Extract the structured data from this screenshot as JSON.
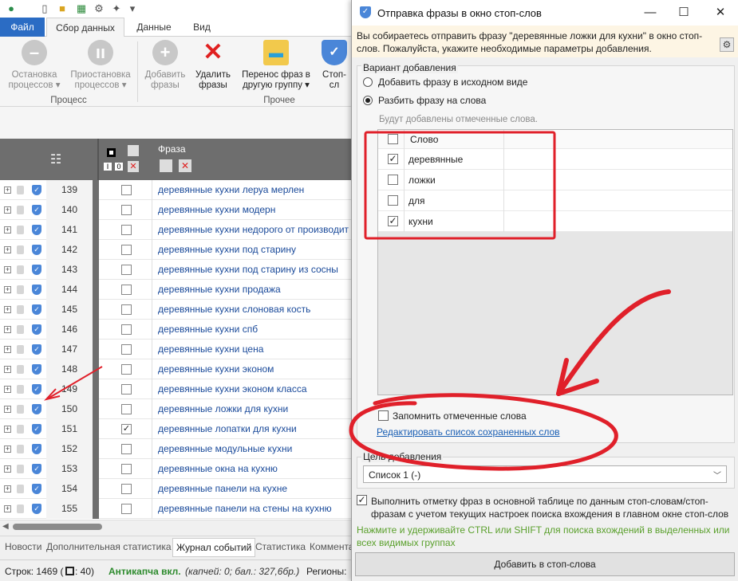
{
  "app": {
    "ribbon_tabs": [
      "Файл",
      "Сбор данных",
      "Данные",
      "Вид"
    ],
    "ribbon_buttons": [
      {
        "line1": "Остановка",
        "line2": "процессов ▾"
      },
      {
        "line1": "Приостановка",
        "line2": "процессов ▾"
      },
      {
        "line1": "Добавить",
        "line2": "фразы"
      },
      {
        "line1": "Удалить",
        "line2": "фразы"
      },
      {
        "line1": "Перенос фраз в",
        "line2": "другую группу ▾"
      },
      {
        "line1": "Стоп-сл",
        "line2": ""
      }
    ],
    "ribbon_groups": [
      "Процесс",
      "Прочее"
    ],
    "grid_header": {
      "phrase_col": "Фраза",
      "toggle_a": "I",
      "toggle_b": "0"
    },
    "rows": [
      {
        "num": "139",
        "phrase": "деревянные кухни леруа мерлен",
        "checked": false
      },
      {
        "num": "140",
        "phrase": "деревянные кухни модерн",
        "checked": false
      },
      {
        "num": "141",
        "phrase": "деревянные кухни недорого от производит",
        "checked": false
      },
      {
        "num": "142",
        "phrase": "деревянные кухни под старину",
        "checked": false
      },
      {
        "num": "143",
        "phrase": "деревянные кухни под старину из сосны",
        "checked": false
      },
      {
        "num": "144",
        "phrase": "деревянные кухни продажа",
        "checked": false
      },
      {
        "num": "145",
        "phrase": "деревянные кухни слоновая кость",
        "checked": false
      },
      {
        "num": "146",
        "phrase": "деревянные кухни спб",
        "checked": false
      },
      {
        "num": "147",
        "phrase": "деревянные кухни цена",
        "checked": false
      },
      {
        "num": "148",
        "phrase": "деревянные кухни эконом",
        "checked": false
      },
      {
        "num": "149",
        "phrase": "деревянные кухни эконом класса",
        "checked": false
      },
      {
        "num": "150",
        "phrase": "деревянные ложки для кухни",
        "checked": false
      },
      {
        "num": "151",
        "phrase": "деревянные лопатки для кухни",
        "checked": true
      },
      {
        "num": "152",
        "phrase": "деревянные модульные кухни",
        "checked": false
      },
      {
        "num": "153",
        "phrase": "деревянные окна на кухню",
        "checked": false
      },
      {
        "num": "154",
        "phrase": "деревянные панели на кухне",
        "checked": false
      },
      {
        "num": "155",
        "phrase": "деревянные панели на стены на кухню",
        "checked": false
      }
    ],
    "bottom_tabs": [
      "Новости",
      "Дополнительная статистика",
      "Журнал событий",
      "Статистика",
      "Коммента"
    ],
    "status": {
      "rows_label": "Строк: 1469 (",
      "rows_checked": ": 40)",
      "anticaptcha": "Антикапча вкл.",
      "captcha_info": "(капчей: 0; бал.: 327,6бр.)",
      "regions": "Регионы:"
    }
  },
  "dialog": {
    "title": "Отправка фразы в окно стоп-слов",
    "notice": "Вы собираетесь отправить фразу \"деревянные ложки для кухни\" в окно стоп-слов. Пожалуйста, укажите необходимые параметры добавления.",
    "variant_label": "Вариант добавления",
    "option_as_is": "Добавить фразу в исходном виде",
    "option_split": "Разбить фразу на слова",
    "words_hint": "Будут добавлены отмеченные слова.",
    "word_col": "Слово",
    "words": [
      {
        "text": "деревянные",
        "checked": true
      },
      {
        "text": "ложки",
        "checked": false
      },
      {
        "text": "для",
        "checked": false
      },
      {
        "text": "кухни",
        "checked": true
      }
    ],
    "remember_label": "Запомнить отмеченные слова",
    "edit_link": "Редактировать список сохраненных слов",
    "target_label": "Цель добавления",
    "target_value": "Список 1 (-)",
    "mark_label": "Выполнить отметку фраз в основной таблице по данным стоп-словам/стоп-фразам с учетом текущих настроек поиска вхождения в главном окне стоп-слов",
    "green_hint": "Нажмите и удерживайте CTRL или SHIFT для поиска вхождений в выделенных или всех видимых группах",
    "add_button": "Добавить в стоп-слова",
    "colors": {
      "accent": "#2b6cc4",
      "annotation": "#e0202a",
      "hint_green": "#5aa02c"
    }
  }
}
